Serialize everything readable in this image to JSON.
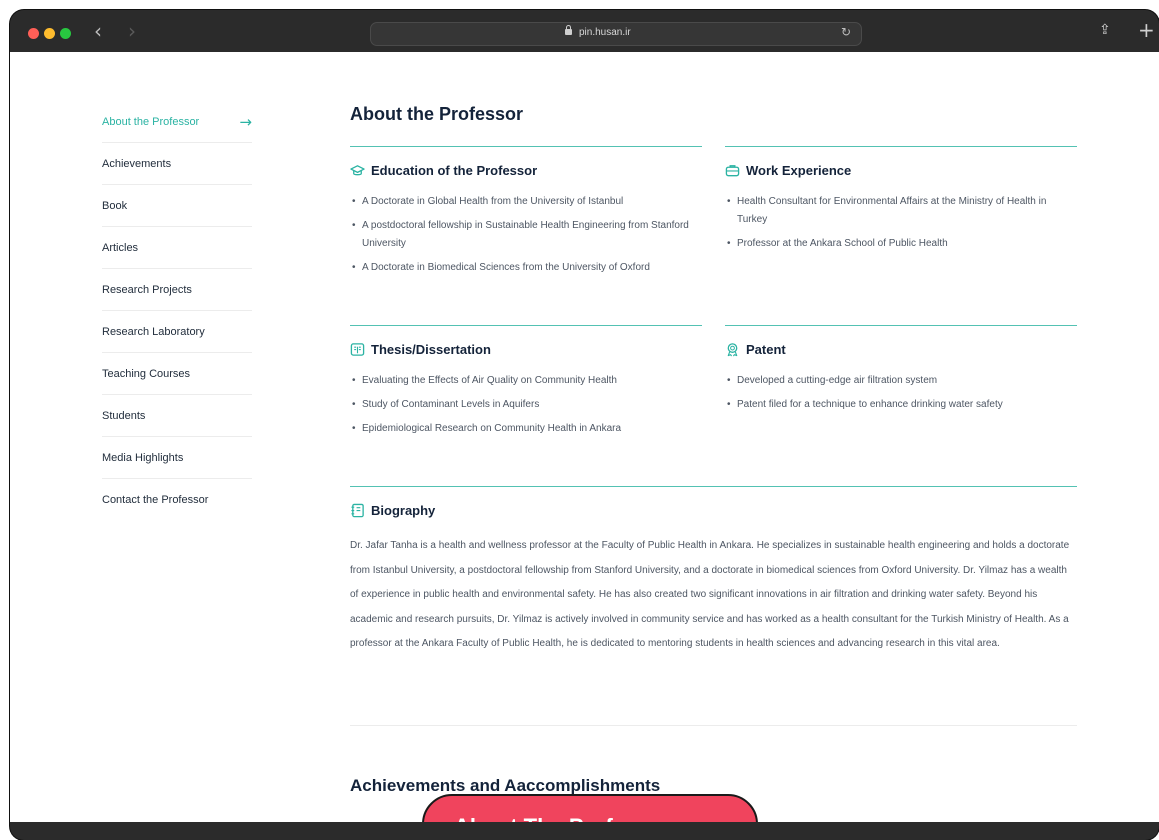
{
  "browser": {
    "url": "pin.husan.ir"
  },
  "sidebar": {
    "items": [
      {
        "label": "About the Professor"
      },
      {
        "label": "Achievements"
      },
      {
        "label": "Book"
      },
      {
        "label": "Articles"
      },
      {
        "label": "Research Projects"
      },
      {
        "label": "Research Laboratory"
      },
      {
        "label": "Teaching Courses"
      },
      {
        "label": "Students"
      },
      {
        "label": "Media Highlights"
      },
      {
        "label": "Contact the Professor"
      }
    ]
  },
  "main": {
    "title": "About the Professor",
    "education": {
      "heading": "Education of the Professor",
      "items": [
        "A Doctorate in Global Health from the University of Istanbul",
        "A postdoctoral fellowship in Sustainable Health Engineering from Stanford University",
        "A Doctorate in Biomedical Sciences from the University of Oxford"
      ]
    },
    "work": {
      "heading": "Work Experience",
      "items": [
        "Health Consultant for Environmental Affairs at the Ministry of Health in Turkey",
        "Professor at the Ankara School of Public Health"
      ]
    },
    "thesis": {
      "heading": "Thesis/Dissertation",
      "items": [
        "Evaluating the Effects of Air Quality on Community Health",
        "Study of Contaminant Levels in Aquifers",
        "Epidemiological Research on Community Health in Ankara"
      ]
    },
    "patent": {
      "heading": "Patent",
      "items": [
        "Developed a cutting-edge air filtration system",
        "Patent filed for a technique to enhance drinking water safety"
      ]
    },
    "biography": {
      "heading": "Biography",
      "text": "Dr. Jafar Tanha is a health and wellness professor at the Faculty of Public Health in Ankara. He specializes in sustainable health engineering and holds a doctorate from Istanbul University, a postdoctoral fellowship from Stanford University, and a doctorate in biomedical sciences from Oxford University. Dr. Yilmaz has a wealth of experience in public health and environmental safety. He has also created two significant innovations in air filtration and drinking water safety. Beyond his academic and research pursuits, Dr. Yilmaz is actively involved in community service and has worked as a health consultant for the Turkish Ministry of Health. As a professor at the Ankara Faculty of Public Health, he is dedicated to mentoring students in health sciences and advancing research in this vital area."
    },
    "achievements_title": "Achievements and Aaccomplishments"
  },
  "overlay": {
    "pill_label": "About The Professor"
  },
  "colors": {
    "accent": "#2bb3a3",
    "pill": "#f0445d"
  }
}
